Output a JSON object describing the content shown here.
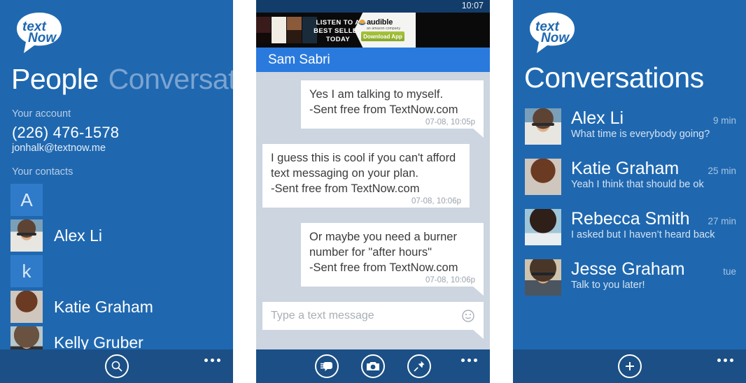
{
  "colors": {
    "brand_blue": "#1f68b0",
    "appbar_blue": "#1b4f85",
    "status_blue": "#123d6b",
    "header_blue": "#2a7ade",
    "chat_bg": "#ccd5e0",
    "link_blue": "#2f6fb5",
    "accent_green": "#a7c43a"
  },
  "logo": {
    "line1": "text",
    "line2": "Now",
    "name": "textnow-logo"
  },
  "people_panel": {
    "pivots": [
      {
        "label": "People",
        "active": true
      },
      {
        "label": "Conversatio",
        "active": false
      }
    ],
    "account_label": "Your account",
    "phone": "(226) 476-1578",
    "email": "jonhalk@textnow.me",
    "contacts_label": "Your contacts",
    "contacts": [
      {
        "name": "",
        "initial": "A",
        "type": "initial"
      },
      {
        "name": "Alex Li",
        "photo": "ph-alex",
        "type": "photo"
      },
      {
        "name": "",
        "initial": "k",
        "type": "initial"
      },
      {
        "name": "Katie Graham",
        "photo": "ph-katie",
        "type": "photo"
      },
      {
        "name": "Kelly Gruber",
        "photo": "ph-kelly",
        "type": "photo"
      }
    ],
    "appbar": {
      "search_icon": "search-icon",
      "more_icon": "more-dots-icon"
    }
  },
  "chat_panel": {
    "clock": "10:07",
    "ad": {
      "slogan_line1": "LISTEN TO A",
      "slogan_line2": "BEST SELLER TODAY",
      "brand": "audible",
      "brand_sub": "an amazon company",
      "cta": "Download App"
    },
    "contact_name": "Sam Sabri",
    "messages": [
      {
        "align": "right",
        "lines": [
          "Yes I am talking to myself."
        ],
        "signature_prefix": "-Sent free from ",
        "signature_link": "TextNow.com",
        "timestamp": "07-08, 10:05p"
      },
      {
        "align": "left",
        "lines": [
          "I guess this is cool if you can't afford",
          "text messaging on your plan."
        ],
        "signature_prefix": "-Sent free from ",
        "signature_link": "TextNow.com",
        "timestamp": "07-08, 10:06p"
      },
      {
        "align": "right",
        "lines": [
          "Or maybe you need a burner",
          "number for \"after hours\""
        ],
        "signature_prefix": "-Sent free from ",
        "signature_link": "TextNow.com",
        "timestamp": "07-08, 10:06p"
      }
    ],
    "composer": {
      "placeholder": "Type a text message",
      "emoji_icon": "smiley-icon"
    },
    "appbar": {
      "new_message_icon": "new-message-icon",
      "camera_icon": "camera-icon",
      "pin_icon": "pushpin-icon",
      "more_icon": "more-dots-icon"
    }
  },
  "conversations_panel": {
    "title": "Conversations",
    "items": [
      {
        "name": "Alex Li",
        "preview": "What time is everybody going?",
        "time": "9 min",
        "photo": "ph-alex"
      },
      {
        "name": "Katie Graham",
        "preview": "Yeah I think that should be ok",
        "time": "25 min",
        "photo": "ph-katie"
      },
      {
        "name": "Rebecca Smith",
        "preview": "I asked but I haven’t heard back",
        "time": "27 min",
        "photo": "ph-rebecca"
      },
      {
        "name": "Jesse Graham",
        "preview": "Talk to you later!",
        "time": "tue",
        "photo": "ph-jesse"
      }
    ],
    "appbar": {
      "add_icon": "plus-icon",
      "more_icon": "more-dots-icon"
    }
  }
}
